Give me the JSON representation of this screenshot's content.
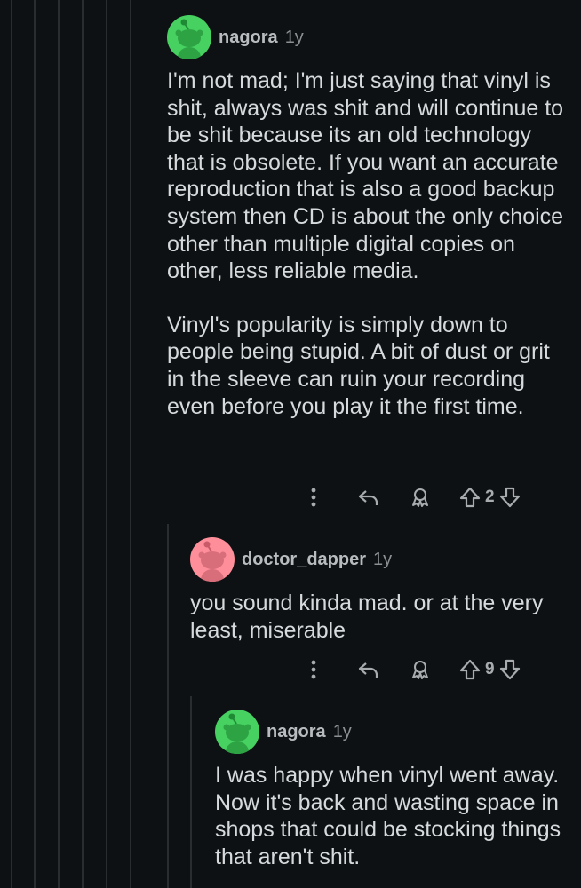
{
  "comments": [
    {
      "username": "nagora",
      "age": "1y",
      "paragraphs": [
        "I'm not mad; I'm just saying that vinyl is shit, always was shit and will continue to be shit because its an old technology that is obsolete. If you want an accurate reproduction that is also a good backup system then CD is about the only choice other than multiple digital copies on other, less reliable media.",
        "Vinyl's popularity is simply down to people being stupid. A bit of dust or grit in the sleeve can ruin your recording even before you play it the first time."
      ],
      "votes": "2",
      "avatar_color": "#46d160"
    },
    {
      "username": "doctor_dapper",
      "age": "1y",
      "paragraphs": [
        "you sound kinda mad. or at the very least, miserable"
      ],
      "votes": "9",
      "avatar_color": "#ff8e9b"
    },
    {
      "username": "nagora",
      "age": "1y",
      "paragraphs": [
        "I was happy when vinyl went away. Now it's back and wasting space in shops that could be stocking things that aren't shit."
      ],
      "avatar_color": "#46d160"
    }
  ],
  "icons": [
    "more-options-icon",
    "reply-icon",
    "award-icon",
    "upvote-icon",
    "downvote-icon",
    "snoo-avatar-icon"
  ]
}
